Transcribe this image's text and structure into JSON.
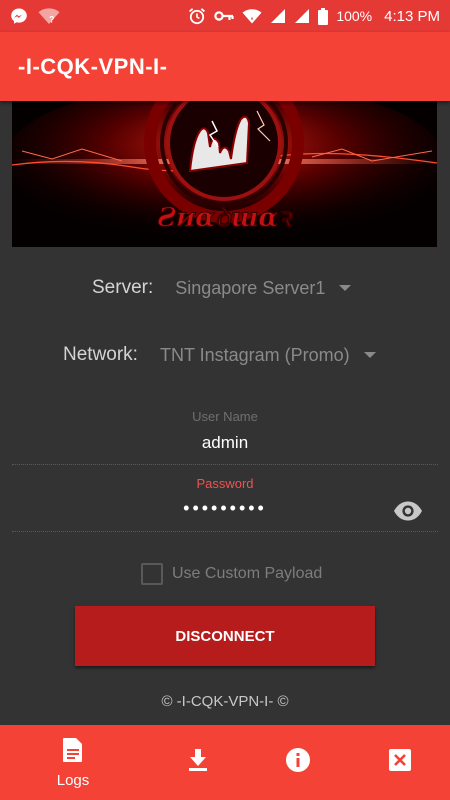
{
  "status_bar": {
    "battery_text": "100%",
    "time": "4:13 PM",
    "icons": [
      "messenger-icon",
      "wifi-question-icon",
      "alarm-icon",
      "vpn-key-icon",
      "wifi-icon",
      "signal-icon",
      "signal-icon",
      "battery-icon"
    ]
  },
  "app_bar": {
    "title": "-I-CQK-VPN-I-"
  },
  "banner": {
    "icon": "rock-hand-logo"
  },
  "server": {
    "label": "Server:",
    "value": "Singapore Server1"
  },
  "network": {
    "label": "Network:",
    "value": "TNT Instagram (Promo)"
  },
  "username": {
    "label": "User Name",
    "value": "admin"
  },
  "password": {
    "label": "Password",
    "value": "•••••••••",
    "toggle_icon": "eye-icon"
  },
  "custom_payload": {
    "label": "Use Custom Payload",
    "checked": false
  },
  "action_button": {
    "label": "DISCONNECT"
  },
  "footer": {
    "copyright": "© -I-CQK-VPN-I- ©"
  },
  "bottom_nav": {
    "items": [
      {
        "label": "Logs",
        "icon": "document-icon"
      },
      {
        "label": "",
        "icon": "download-icon"
      },
      {
        "label": "",
        "icon": "info-icon"
      },
      {
        "label": "",
        "icon": "close-box-icon"
      }
    ]
  },
  "colors": {
    "status_bar": "#e53935",
    "primary": "#f44336",
    "button": "#b71c1c",
    "background": "#333333",
    "accent_label": "#ef5350"
  }
}
